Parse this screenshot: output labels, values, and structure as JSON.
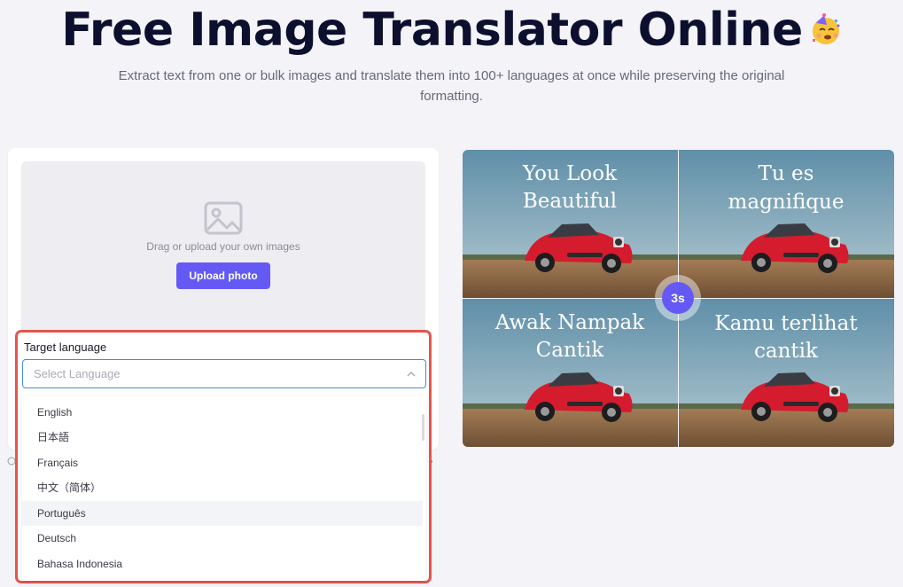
{
  "hero": {
    "title": "Free Image Translator Online",
    "emoji": "party-face-emoji",
    "subtitle": "Extract text from one or bulk images and translate them into 100+ languages at once while preserving the original formatting."
  },
  "upload": {
    "prompt": "Drag or upload your own images",
    "button_label": "Upload photo"
  },
  "language": {
    "label": "Target language",
    "placeholder": "Select Language",
    "options": [
      "English",
      "日本語",
      "Français",
      "中文（简体）",
      "Português",
      "Deutsch",
      "Bahasa Indonesia"
    ],
    "hovered_option": "Português"
  },
  "preview": {
    "captions": [
      {
        "line1": "You Look",
        "line2": "Beautiful"
      },
      {
        "line1": "Tu es",
        "line2": "magnifique"
      },
      {
        "line1": "Awak Nampak",
        "line2": "Cantik"
      },
      {
        "line1": "Kamu terlihat",
        "line2": "cantik"
      }
    ],
    "timer": "3s"
  },
  "colors": {
    "accent": "#6559f5",
    "highlight_border": "#e2574f",
    "focus_border": "#3f8fe8",
    "title": "#0c0f2e",
    "background": "#f3f3f8"
  }
}
